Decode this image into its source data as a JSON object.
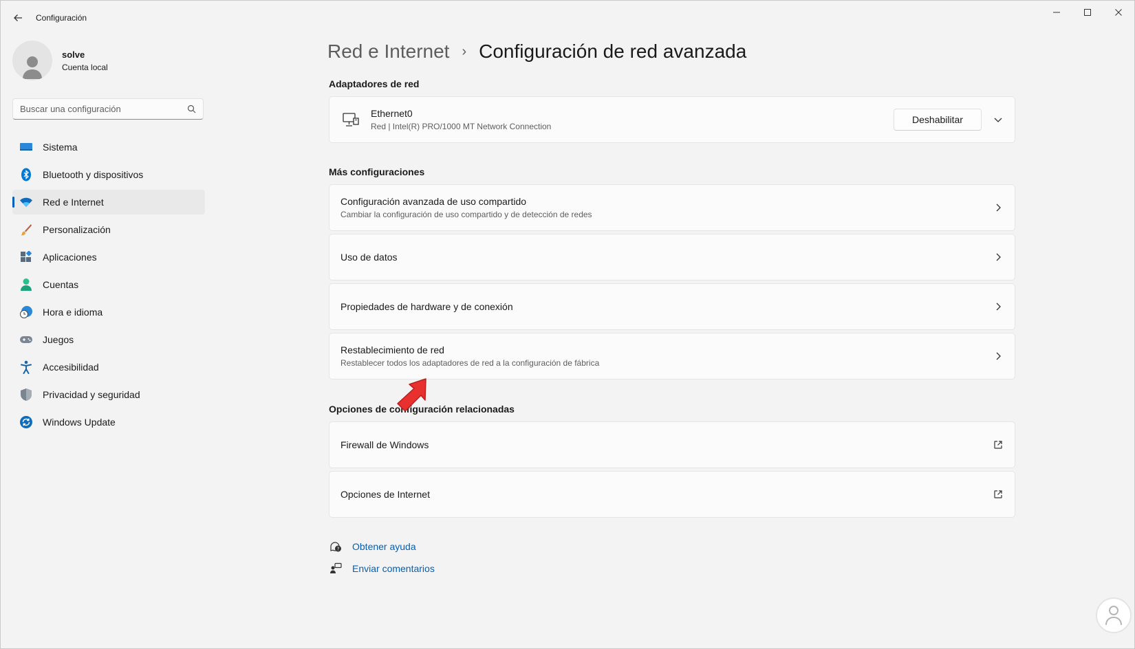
{
  "window": {
    "title": "Configuración"
  },
  "profile": {
    "name": "solve",
    "account_type": "Cuenta local"
  },
  "search": {
    "placeholder": "Buscar una configuración"
  },
  "nav": [
    {
      "label": "Sistema",
      "icon": "monitor-icon"
    },
    {
      "label": "Bluetooth y dispositivos",
      "icon": "bluetooth-icon"
    },
    {
      "label": "Red e Internet",
      "icon": "wifi-icon",
      "active": true
    },
    {
      "label": "Personalización",
      "icon": "brush-icon"
    },
    {
      "label": "Aplicaciones",
      "icon": "apps-icon"
    },
    {
      "label": "Cuentas",
      "icon": "person-icon"
    },
    {
      "label": "Hora e idioma",
      "icon": "globe-clock-icon"
    },
    {
      "label": "Juegos",
      "icon": "gamepad-icon"
    },
    {
      "label": "Accesibilidad",
      "icon": "accessibility-icon"
    },
    {
      "label": "Privacidad y seguridad",
      "icon": "shield-icon"
    },
    {
      "label": "Windows Update",
      "icon": "update-icon"
    }
  ],
  "breadcrumb": {
    "parent": "Red e Internet",
    "separator": "›",
    "current": "Configuración de red avanzada"
  },
  "adapters": {
    "heading": "Adaptadores de red",
    "items": [
      {
        "name": "Ethernet0",
        "description": "Red | Intel(R) PRO/1000 MT Network Connection",
        "button": "Deshabilitar"
      }
    ]
  },
  "more_settings": {
    "heading": "Más configuraciones",
    "items": [
      {
        "title": "Configuración avanzada de uso compartido",
        "subtitle": "Cambiar la configuración de uso compartido y de detección de redes"
      },
      {
        "title": "Uso de datos",
        "subtitle": ""
      },
      {
        "title": "Propiedades de hardware y de conexión",
        "subtitle": ""
      },
      {
        "title": "Restablecimiento de red",
        "subtitle": "Restablecer todos los adaptadores de red a la configuración de fábrica"
      }
    ]
  },
  "related": {
    "heading": "Opciones de configuración relacionadas",
    "items": [
      {
        "title": "Firewall de Windows"
      },
      {
        "title": "Opciones de Internet"
      }
    ]
  },
  "help": {
    "get_help": "Obtener ayuda",
    "feedback": "Enviar comentarios"
  },
  "colors": {
    "accent": "#005fb8",
    "annotation_arrow": "#e8312f"
  }
}
